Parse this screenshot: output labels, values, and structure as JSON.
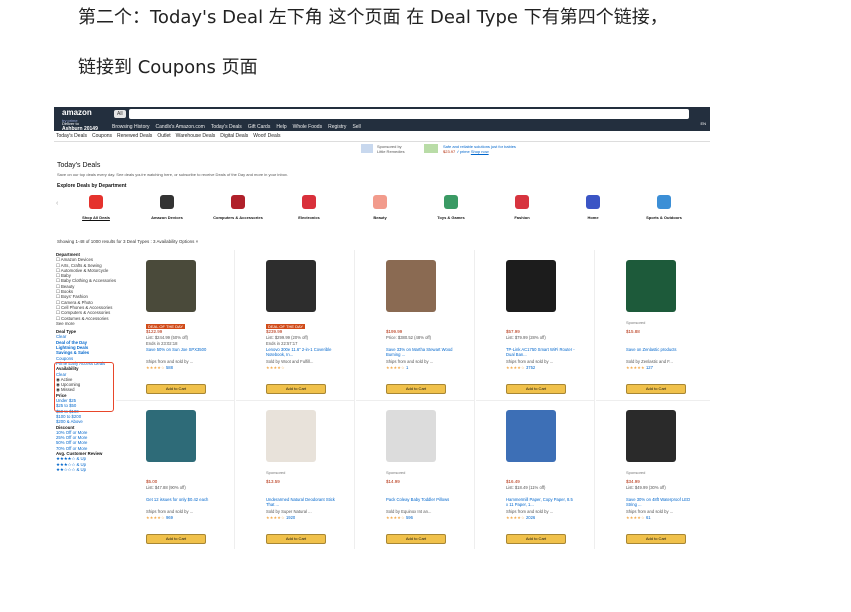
{
  "captions": {
    "line1": "第二个：Today's Deal 左下角  这个页面  在 Deal Type  下有第四个链接，",
    "line2": "链接到 Coupons  页面"
  },
  "topbar": {
    "logo": "amazon",
    "logo_sub": "try prime",
    "all_label": "All",
    "deliver_line1": "Deliver to",
    "deliver_line2": "Ashburn 20149",
    "nav": [
      "Browsing History",
      "Candlx's Amazon.com",
      "Today's Deals",
      "Gift Cards",
      "Help",
      "Whole Foods",
      "Registry",
      "Sell"
    ],
    "lang": "EN"
  },
  "subnav": [
    "Today's Deals",
    "Coupons",
    "Renewed Deals",
    "Outlet",
    "Warehouse Deals",
    "Digital Deals",
    "Woot! Deals"
  ],
  "sponsor": {
    "by": "Sponsored by",
    "brand": "Little Remedies",
    "text": "Safe and reliable solutions just for babies",
    "price": "$23.97",
    "prime": "✓prime",
    "shop": "Shop now"
  },
  "page": {
    "title": "Today's Deals",
    "subtitle": "Save on our top deals every day. See deals you're watching here, or subscribe to receive Deals of the Day and more in your inbox.",
    "explore": "Explore Deals by Department",
    "showing": "Showing 1-48 of 1000 results for 3 Deal Types : 3 Availability Options  ×"
  },
  "categories": [
    {
      "label": "Shop All Deals",
      "color": "#e5322d"
    },
    {
      "label": "Amazon Devices",
      "color": "#333333"
    },
    {
      "label": "Computers & Accessories",
      "color": "#b0202a"
    },
    {
      "label": "Electronics",
      "color": "#d9303b"
    },
    {
      "label": "Beauty",
      "color": "#f29b8c"
    },
    {
      "label": "Toys & Games",
      "color": "#3a9a64"
    },
    {
      "label": "Fashion",
      "color": "#d7343f"
    },
    {
      "label": "Home",
      "color": "#3b55c5"
    },
    {
      "label": "Sports & Outdoors",
      "color": "#3c8fd6"
    }
  ],
  "sidebar": {
    "department_head": "Department",
    "departments": [
      "Amazon Devices",
      "Arts, Crafts & Sewing",
      "Automotive & Motorcycle",
      "Baby",
      "Baby Clothing & Accessories",
      "Beauty",
      "Books",
      "Boys' Fashion",
      "Camera & Photo",
      "Cell Phones & Accessories",
      "Computers & Accessories",
      "Costumes & Accessories",
      "See more"
    ],
    "deal_type_head": "Deal Type",
    "deal_types": [
      "Clear",
      "Deal of the Day",
      "Lightning Deals",
      "Savings & Sales",
      "Coupons",
      "Prime Early Access Deals"
    ],
    "availability_head": "Availability",
    "availability": [
      "Clear",
      "Active",
      "Upcoming",
      "Missed"
    ],
    "price_head": "Price",
    "prices": [
      "Under $25",
      "$25 to $50",
      "$50 to $100",
      "$100 to $200",
      "$200 & Above"
    ],
    "discount_head": "Discount",
    "discounts": [
      "10% Off or More",
      "25% Off or More",
      "50% Off or More",
      "70% Off or More"
    ],
    "review_head": "Avg. Customer Review",
    "reviews": [
      "★★★★☆ & Up",
      "★★★☆☆ & Up",
      "★★☆☆☆ & Up"
    ]
  },
  "products": [
    {
      "badge": "DEAL OF THE DAY",
      "price": "$122.99",
      "list": "List: $244.99 (50% off)",
      "ends": "Ends in 23:02:18",
      "title": "Save 50% on Sun Joe SPX3500",
      "ship": "Ships from and sold by ...",
      "stars": "★★★★☆",
      "count": "588",
      "sponsored": "",
      "img": "#4a4a3a"
    },
    {
      "badge": "DEAL OF THE DAY",
      "price": "$239.99",
      "list": "List: $299.99 (20% off)",
      "ends": "Ends in 22:57:17",
      "title": "Lenovo 300e 11.6\" 2-in-1 Coverible Notebook, In...",
      "ship": "Sold by Woot and Fulfill...",
      "stars": "★★★★☆",
      "count": "",
      "sponsored": "",
      "img": "#2d2d2d"
    },
    {
      "badge": "",
      "price": "$199.99",
      "list": "Price: $380.52 (48% off)",
      "ends": "",
      "title": "Save 33% on Martha Stewart Wood Burning ...",
      "ship": "Ships from and sold by ...",
      "stars": "★★★★☆",
      "count": "1",
      "sponsored": "",
      "img": "#8a6a52"
    },
    {
      "badge": "",
      "price": "$57.99",
      "list": "List: $79.99 (28% off)",
      "ends": "",
      "title": "TP-Link AC1750 Smart WiFi Router - Dual Ban...",
      "ship": "Ships from and sold by ...",
      "stars": "★★★★☆",
      "count": "3752",
      "sponsored": "",
      "img": "#1c1c1c"
    },
    {
      "badge": "",
      "price": "$15.88",
      "list": "",
      "ends": "",
      "title": "Save on Zenlastic products",
      "ship": "Sold by Zenlastic and F...",
      "stars": "★★★★★",
      "count": "127",
      "sponsored": "Sponsored",
      "img": "#1d5a3a"
    },
    {
      "badge": "",
      "price": "$5.00",
      "list": "List: $47.88 (90% off)",
      "ends": "",
      "title": "Get 12 issues for only $0.42 each",
      "ship": "Ships from and sold by ...",
      "stars": "★★★★☆",
      "count": "969",
      "sponsored": "",
      "img": "#2e6b78"
    },
    {
      "badge": "",
      "price": "$13.59",
      "list": "",
      "ends": "",
      "title": "Underarmed Natural Deodorant Stick That ...",
      "ship": "Sold by Super Natural ...",
      "stars": "★★★★☆",
      "count": "1920",
      "sponsored": "Sponsored",
      "img": "#e8e2da"
    },
    {
      "badge": "",
      "price": "$14.99",
      "list": "",
      "ends": "",
      "title": "Pack Coleay Baby Toddler Pillows",
      "ship": "Sold by Equinox Int an...",
      "stars": "★★★★☆",
      "count": "596",
      "sponsored": "Sponsored",
      "img": "#dcdcdc"
    },
    {
      "badge": "",
      "price": "$16.49",
      "list": "List: $18.49 (11% off)",
      "ends": "",
      "title": "Hammermill Paper, Copy Paper, 8.5 x 11 Paper, 1...",
      "ship": "Ships from and sold by ...",
      "stars": "★★★★☆",
      "count": "2026",
      "sponsored": "",
      "img": "#3d6fb6"
    },
    {
      "badge": "",
      "price": "$34.99",
      "list": "List: $49.99 (30% off)",
      "ends": "",
      "title": "Save 30% on 48ft Waterproof LED String ...",
      "ship": "Ships from and sold by ...",
      "stars": "★★★★☆",
      "count": "61",
      "sponsored": "Sponsored",
      "img": "#2a2a2a"
    }
  ],
  "add_to_cart": "Add to Cart"
}
